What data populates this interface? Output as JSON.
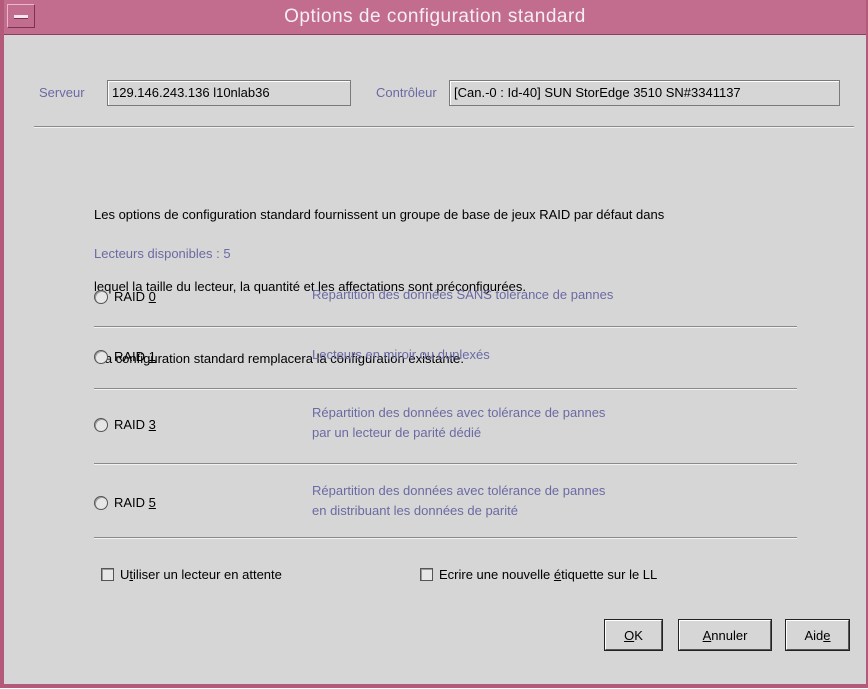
{
  "window": {
    "title": "Options de configuration standard"
  },
  "server": {
    "label": "Serveur",
    "value": "129.146.243.136 l10nlab36"
  },
  "controller": {
    "label": "Contrôleur",
    "value": "[Can.-0 : Id-40] SUN StorEdge 3510 SN#3341137"
  },
  "description": {
    "line1": "Les options de configuration standard fournissent un groupe de base de jeux RAID par défaut dans",
    "line2": "lequel la taille du lecteur, la quantité et les affectations sont préconfigurées.",
    "line3": " La configuration standard remplacera la configuration existante."
  },
  "available_drives": "Lecteurs disponibles : 5",
  "raid_options": [
    {
      "prefix": "RAID ",
      "mnemonic": "0",
      "desc1": "Répartition des données SANS tolérance de pannes",
      "desc2": "",
      "selected": false
    },
    {
      "prefix": "RAID ",
      "mnemonic": "1",
      "desc1": "Lecteurs en miroir ou duplexés",
      "desc2": "",
      "selected": false
    },
    {
      "prefix": "RAID ",
      "mnemonic": "3",
      "desc1": "Répartition des données avec tolérance de pannes",
      "desc2": "par un lecteur de parité dédié",
      "selected": false
    },
    {
      "prefix": "RAID ",
      "mnemonic": "5",
      "desc1": "Répartition des données avec tolérance de pannes",
      "desc2": "en distribuant les données de parité",
      "selected": false
    }
  ],
  "checkboxes": {
    "standby": {
      "first": "U",
      "u": "t",
      "rest": "iliser un lecteur en attente",
      "checked": false
    },
    "label": {
      "before": "Ecrire une nouvelle ",
      "u": "é",
      "rest": "tiquette sur le LL",
      "checked": false
    }
  },
  "buttons": {
    "ok": {
      "u": "O",
      "rest": "K"
    },
    "cancel": {
      "u": "A",
      "rest": "nnuler"
    },
    "help": {
      "before": "Aid",
      "u": "e"
    }
  },
  "colors": {
    "titlebar": "#c26d8e",
    "border": "#b3597a",
    "background": "#d6d6d6",
    "label_blue": "#6a6aa4"
  }
}
